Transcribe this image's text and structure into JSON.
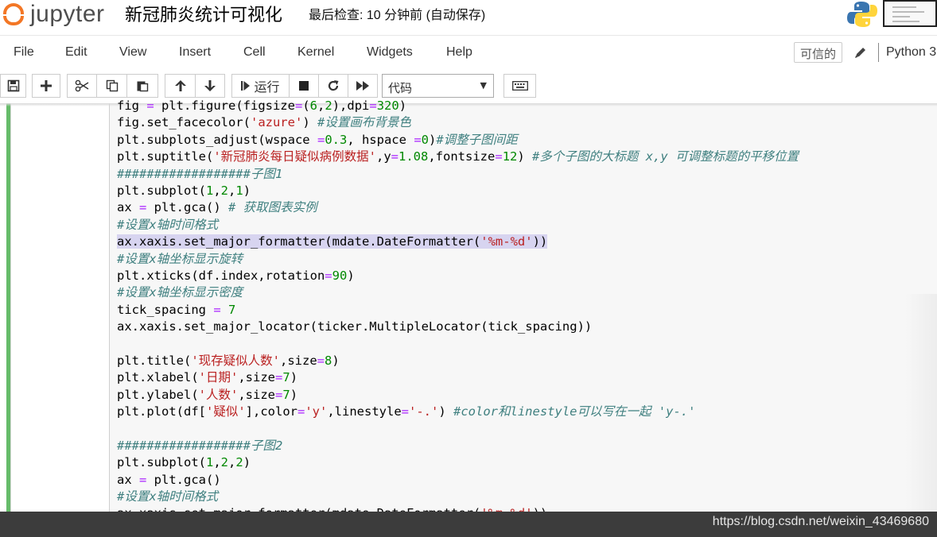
{
  "header": {
    "logo_text": "jupyter",
    "notebook_title": "新冠肺炎统计可视化",
    "checkpoint": "最后检查: 10 分钟前  (自动保存)"
  },
  "menu": {
    "items": [
      "File",
      "Edit",
      "View",
      "Insert",
      "Cell",
      "Kernel",
      "Widgets",
      "Help"
    ],
    "trusted": "可信的",
    "kernel": "Python 3"
  },
  "toolbar": {
    "run_label": "运行",
    "cell_type": "代码",
    "cell_type_options": [
      "代码"
    ]
  },
  "code_lines": [
    "fig = plt.figure(figsize=(6,2),dpi=320)",
    "fig.set_facecolor('azure') #设置画布背景色",
    "plt.subplots_adjust(wspace =0.3, hspace =0)#调整子图间距",
    "plt.suptitle('新冠肺炎每日疑似病例数据',y=1.08,fontsize=12) #多个子图的大标题 x,y 可调整标题的平移位置",
    "##################子图1",
    "plt.subplot(1,2,1)",
    "ax = plt.gca() # 获取图表实例",
    "#设置x轴时间格式",
    "ax.xaxis.set_major_formatter(mdate.DateFormatter('%m-%d'))",
    "#设置x轴坐标显示旋转",
    "plt.xticks(df.index,rotation=90)",
    "#设置x轴坐标显示密度",
    "tick_spacing = 7",
    "ax.xaxis.set_major_locator(ticker.MultipleLocator(tick_spacing))",
    "",
    "plt.title('现存疑似人数',size=8)",
    "plt.xlabel('日期',size=7)",
    "plt.ylabel('人数',size=7)",
    "plt.plot(df['疑似'],color='y',linestyle='-.') #color和linestyle可以写在一起 'y-.'",
    "",
    "##################子图2",
    "plt.subplot(1,2,2)",
    "ax = plt.gca()",
    "#设置x轴时间格式",
    "ax.xaxis.set_major_formatter(mdate.DateFormatter('%m-%d'))"
  ],
  "watermark": "https://blog.csdn.net/weixin_43469680",
  "colors": {
    "logo_orange": "#f37726",
    "cell_selected_bar": "#66bb6a",
    "code_string": "#ba2121",
    "code_number": "#008800",
    "code_comment": "#408080",
    "line_highlight": "#d7d4f0"
  }
}
